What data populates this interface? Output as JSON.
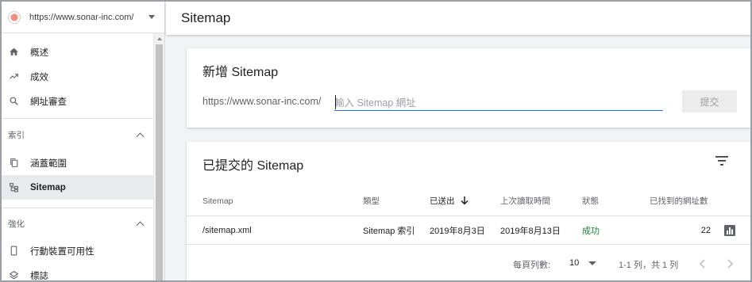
{
  "property": {
    "url": "https://www.sonar-inc.com/"
  },
  "header": {
    "title": "Sitemap"
  },
  "sidebar": {
    "items": [
      {
        "label": "概述",
        "icon": "home-icon"
      },
      {
        "label": "成效",
        "icon": "trending-up-icon"
      },
      {
        "label": "網址審查",
        "icon": "search-icon"
      }
    ],
    "section_index": {
      "title": "索引",
      "items": [
        {
          "label": "涵蓋範圍",
          "icon": "copy-pages-icon"
        },
        {
          "label": "Sitemap",
          "icon": "sitemap-icon",
          "active": true
        }
      ]
    },
    "section_enhance": {
      "title": "強化",
      "items": [
        {
          "label": "行動裝置可用性",
          "icon": "phone-icon"
        },
        {
          "label": "標誌",
          "icon": "layers-icon"
        }
      ]
    }
  },
  "add_card": {
    "title": "新增 Sitemap",
    "prefix": "https://www.sonar-inc.com/",
    "placeholder": "輸入 Sitemap 網址",
    "submit_label": "提交"
  },
  "list_card": {
    "title": "已提交的 Sitemap",
    "columns": {
      "sitemap": "Sitemap",
      "type": "類型",
      "sent": "已送出",
      "last_read": "上次讀取時間",
      "status": "狀態",
      "found_urls": "已找到的網址數"
    },
    "rows": [
      {
        "sitemap": "/sitemap.xml",
        "type": "Sitemap 索引",
        "sent": "2019年8月3日",
        "last_read": "2019年8月13日",
        "status": "成功",
        "found_urls": "22"
      }
    ],
    "pagination": {
      "rows_per_page_label": "每頁列數:",
      "rows_per_page": "10",
      "range": "1-1 列，共 1 列"
    }
  },
  "colors": {
    "accent": "#1a73e8",
    "success": "#188038",
    "active_nav_bg": "#e8eaed"
  }
}
